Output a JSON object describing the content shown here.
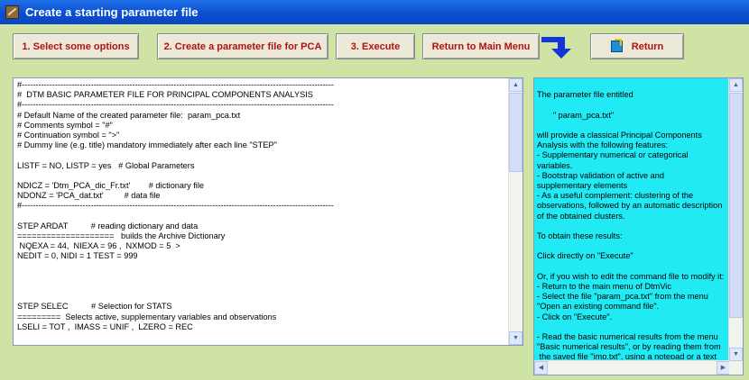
{
  "window": {
    "title": "Create a starting parameter file"
  },
  "toolbar": {
    "select_options": "1.  Select some options",
    "create_pca": "2.  Create a parameter file for PCA",
    "execute": "3.  Execute",
    "main_menu": "Return to Main Menu",
    "return": "Return"
  },
  "icons": {
    "arrow": "blue-down-right-arrow-icon",
    "return": "return-icon"
  },
  "left_panel": {
    "text": "#-----------------------------------------------------------------------------------------------------------------\n#  DTM BASIC PARAMETER FILE FOR PRINCIPAL COMPONENTS ANALYSIS\n#-----------------------------------------------------------------------------------------------------------------\n# Default Name of the created parameter file:  param_pca.txt\n# Comments symbol = \"#\"\n# Continuation symbol = \">\"\n# Dummy line (e.g. title) mandatory immediately after each line \"STEP\"\n\nLISTF = NO, LISTP = yes   # Global Parameters\n\nNDICZ = 'Dtm_PCA_dic_Fr.txt'        # dictionary file\nNDONZ = 'PCA_dat.txt'         # data file\n#-----------------------------------------------------------------------------------------------------------------\n\nSTEP ARDAT          # reading dictionary and data\n====================   builds the Archive Dictionary\n NQEXA = 44,  NIEXA = 96 ,  NXMOD = 5  >\nNEDIT = 0, NIDI = 1 TEST = 999\n\n\n\n\nSTEP SELEC          # Selection for STATS\n=========  Selects active, supplementary variables and observations\nLSELI = TOT ,  IMASS = UNIF ,  LZERO = REC\n\n#---  selections of variables (columns)"
  },
  "right_panel": {
    "text": "\nThe parameter file entitled\n\n       \" param_pca.txt\"\n\nwill provide a classical Principal Components\nAnalysis with the following features:\n- Supplementary numerical or categorical\nvariables.\n- Bootstrap validation of active and\nsupplementary elements\n- As a useful complement: clustering of the\nobservations, followed by an automatic description\nof the obtained clusters.\n\nTo obtain these results:\n\nClick directly on \"Execute\"\n\nOr, if you wish to edit the command file to modify it:\n- Return to the main menu of DtmVic\n- Select the file \"param_pca.txt\" from the menu\n\"Open an existing command file\".\n- Click on \"Execute\".\n\n- Read the basic numerical results from the menu\n\"Basic numerical results\", or by reading them from\n the saved file \"imp.txt\", using a notepad or a text"
  }
}
